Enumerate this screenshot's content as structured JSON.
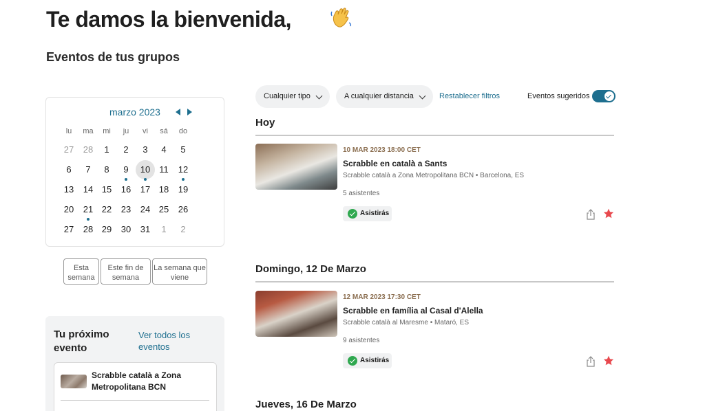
{
  "header": {
    "welcome": "Te damos la bienvenida,",
    "wave_icon": "waving-hand-icon",
    "subtitle": "Eventos de tus grupos"
  },
  "calendar": {
    "month": "marzo 2023",
    "weekdays": [
      "lu",
      "ma",
      "mi",
      "ju",
      "vi",
      "sá",
      "do"
    ],
    "weeks": [
      [
        "27",
        "28",
        "1",
        "2",
        "3",
        "4",
        "5"
      ],
      [
        "6",
        "7",
        "8",
        "9",
        "10",
        "11",
        "12"
      ],
      [
        "13",
        "14",
        "15",
        "16",
        "17",
        "18",
        "19"
      ],
      [
        "20",
        "21",
        "22",
        "23",
        "24",
        "25",
        "26"
      ],
      [
        "27",
        "28",
        "29",
        "30",
        "31",
        "1",
        "2"
      ]
    ],
    "today": "10",
    "days_with_events": [
      "9",
      "10",
      "12",
      "21"
    ]
  },
  "quick_filters": [
    "Esta semana",
    "Este fin de semana",
    "La semana que viene"
  ],
  "next_event": {
    "title": "Tu próximo evento",
    "view_all": "Ver todos los eventos",
    "event_title": "Scrabble català a Zona Metropolitana BCN"
  },
  "filters": {
    "type": "Cualquier tipo",
    "distance": "A cualquier distancia",
    "reset": "Restablecer filtros",
    "suggested_label": "Eventos sugeridos",
    "suggested_on": true
  },
  "sections": [
    {
      "heading": "Hoy",
      "event": {
        "date": "10 MAR 2023 18:00 CET",
        "title": "Scrabble en català a Sants",
        "group": "Scrabble català a Zona Metropolitana BCN • Barcelona, ES",
        "attendees": "5 asistentes",
        "status": "Asistirás"
      }
    },
    {
      "heading": "Domingo, 12 De Marzo",
      "event": {
        "date": "12 MAR 2023 17:30 CET",
        "title": "Scrabble en família al Casal d'Alella",
        "group": "Scrabble català al Maresme • Mataró, ES",
        "attendees": "9 asistentes",
        "status": "Asistirás"
      }
    },
    {
      "heading": "Jueves, 16 De Marzo"
    }
  ],
  "colors": {
    "accent": "#1e6f8f",
    "date_brown": "#8a6d4f",
    "attending_green": "#2fa84f",
    "star_red": "#e8484d"
  }
}
